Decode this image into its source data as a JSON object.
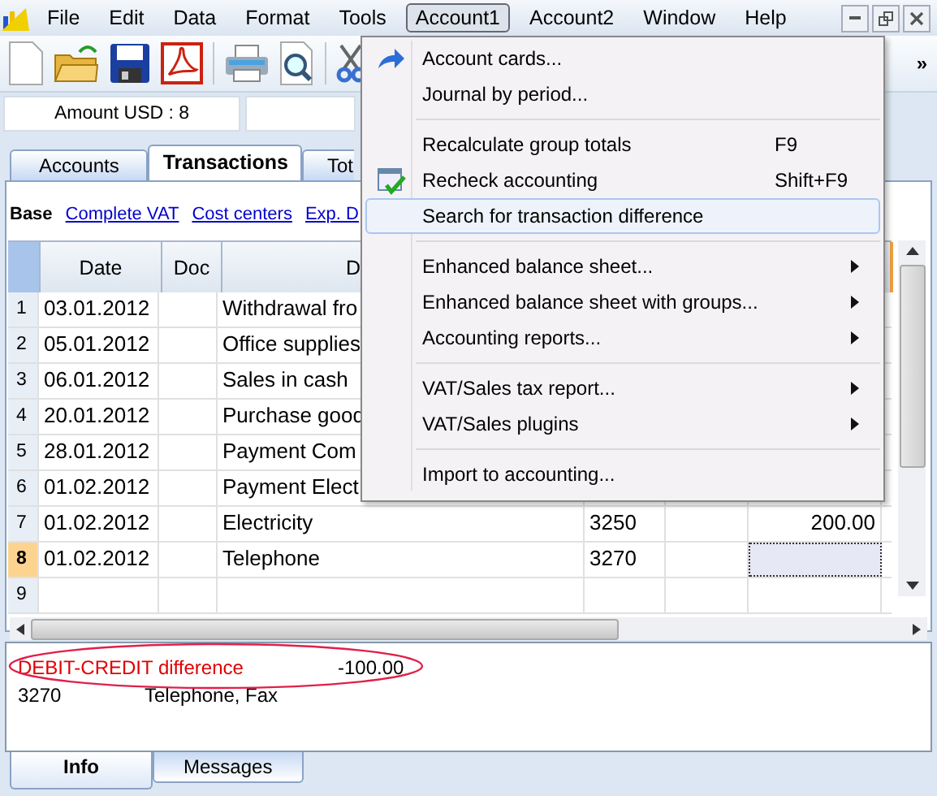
{
  "menubar": [
    {
      "label": "File",
      "selected": false
    },
    {
      "label": "Edit",
      "selected": false
    },
    {
      "label": "Data",
      "selected": false
    },
    {
      "label": "Format",
      "selected": false
    },
    {
      "label": "Tools",
      "selected": false
    },
    {
      "label": "Account1",
      "selected": true
    },
    {
      "label": "Account2",
      "selected": false
    },
    {
      "label": "Window",
      "selected": false
    },
    {
      "label": "Help",
      "selected": false
    }
  ],
  "toolbar": {
    "overflow": "»"
  },
  "amount_field": {
    "value": "Amount USD : 8"
  },
  "tabs": [
    {
      "label": "Accounts",
      "selected": false
    },
    {
      "label": "Transactions",
      "selected": true
    },
    {
      "label": "Tot",
      "selected": false
    }
  ],
  "views": [
    {
      "label": "Base",
      "selected": true
    },
    {
      "label": "Complete VAT",
      "selected": false
    },
    {
      "label": "Cost centers",
      "selected": false
    },
    {
      "label": "Exp. D",
      "selected": false
    }
  ],
  "table": {
    "columns": [
      "Date",
      "Doc",
      "D"
    ],
    "rows": [
      {
        "number": "1",
        "date": "03.01.2012",
        "description": "Withdrawal fro",
        "selected": false
      },
      {
        "number": "2",
        "date": "05.01.2012",
        "description": "Office supplies",
        "selected": false
      },
      {
        "number": "3",
        "date": "06.01.2012",
        "description": "Sales in cash",
        "selected": false
      },
      {
        "number": "4",
        "date": "20.01.2012",
        "description": "Purchase good",
        "selected": false
      },
      {
        "number": "5",
        "date": "28.01.2012",
        "description": "Payment Com",
        "selected": false
      },
      {
        "number": "6",
        "date": "01.02.2012",
        "description": "Payment Elect",
        "selected": false
      },
      {
        "number": "7",
        "date": "01.02.2012",
        "description": "Electricity",
        "account": "3250",
        "amount": "200.00",
        "selected": false
      },
      {
        "number": "8",
        "date": "01.02.2012",
        "description": "Telephone",
        "account": "3270",
        "selected": true
      },
      {
        "number": "9",
        "selected": false
      }
    ]
  },
  "menu": {
    "groups": [
      [
        {
          "label": "Account cards...",
          "has_icon": true,
          "selected": false
        },
        {
          "label": "Journal by period...",
          "selected": false
        }
      ],
      [
        {
          "label": "Recalculate group totals",
          "shortcut": "F9",
          "selected": false
        },
        {
          "label": "Recheck accounting",
          "shortcut": "Shift+F9",
          "has_icon": true,
          "selected": false
        },
        {
          "label": "Search for transaction difference",
          "selected": true
        }
      ],
      [
        {
          "label": "Enhanced balance sheet...",
          "submenu": true,
          "selected": false
        },
        {
          "label": "Enhanced balance sheet with groups...",
          "submenu": true,
          "selected": false
        },
        {
          "label": "Accounting reports...",
          "submenu": true,
          "selected": false
        }
      ],
      [
        {
          "label": "VAT/Sales tax report...",
          "submenu": true,
          "selected": false
        },
        {
          "label": "VAT/Sales plugins",
          "submenu": true,
          "selected": false
        }
      ],
      [
        {
          "label": "Import to accounting...",
          "selected": false
        }
      ]
    ]
  },
  "info": {
    "error": {
      "label": "DEBIT-CREDIT difference",
      "value": "-100.00",
      "highlighted": true
    },
    "detail": {
      "account": "3270",
      "description": "Telephone, Fax"
    }
  },
  "bottom_tabs": [
    {
      "label": "Info",
      "selected": true
    },
    {
      "label": "Messages",
      "selected": false
    }
  ]
}
